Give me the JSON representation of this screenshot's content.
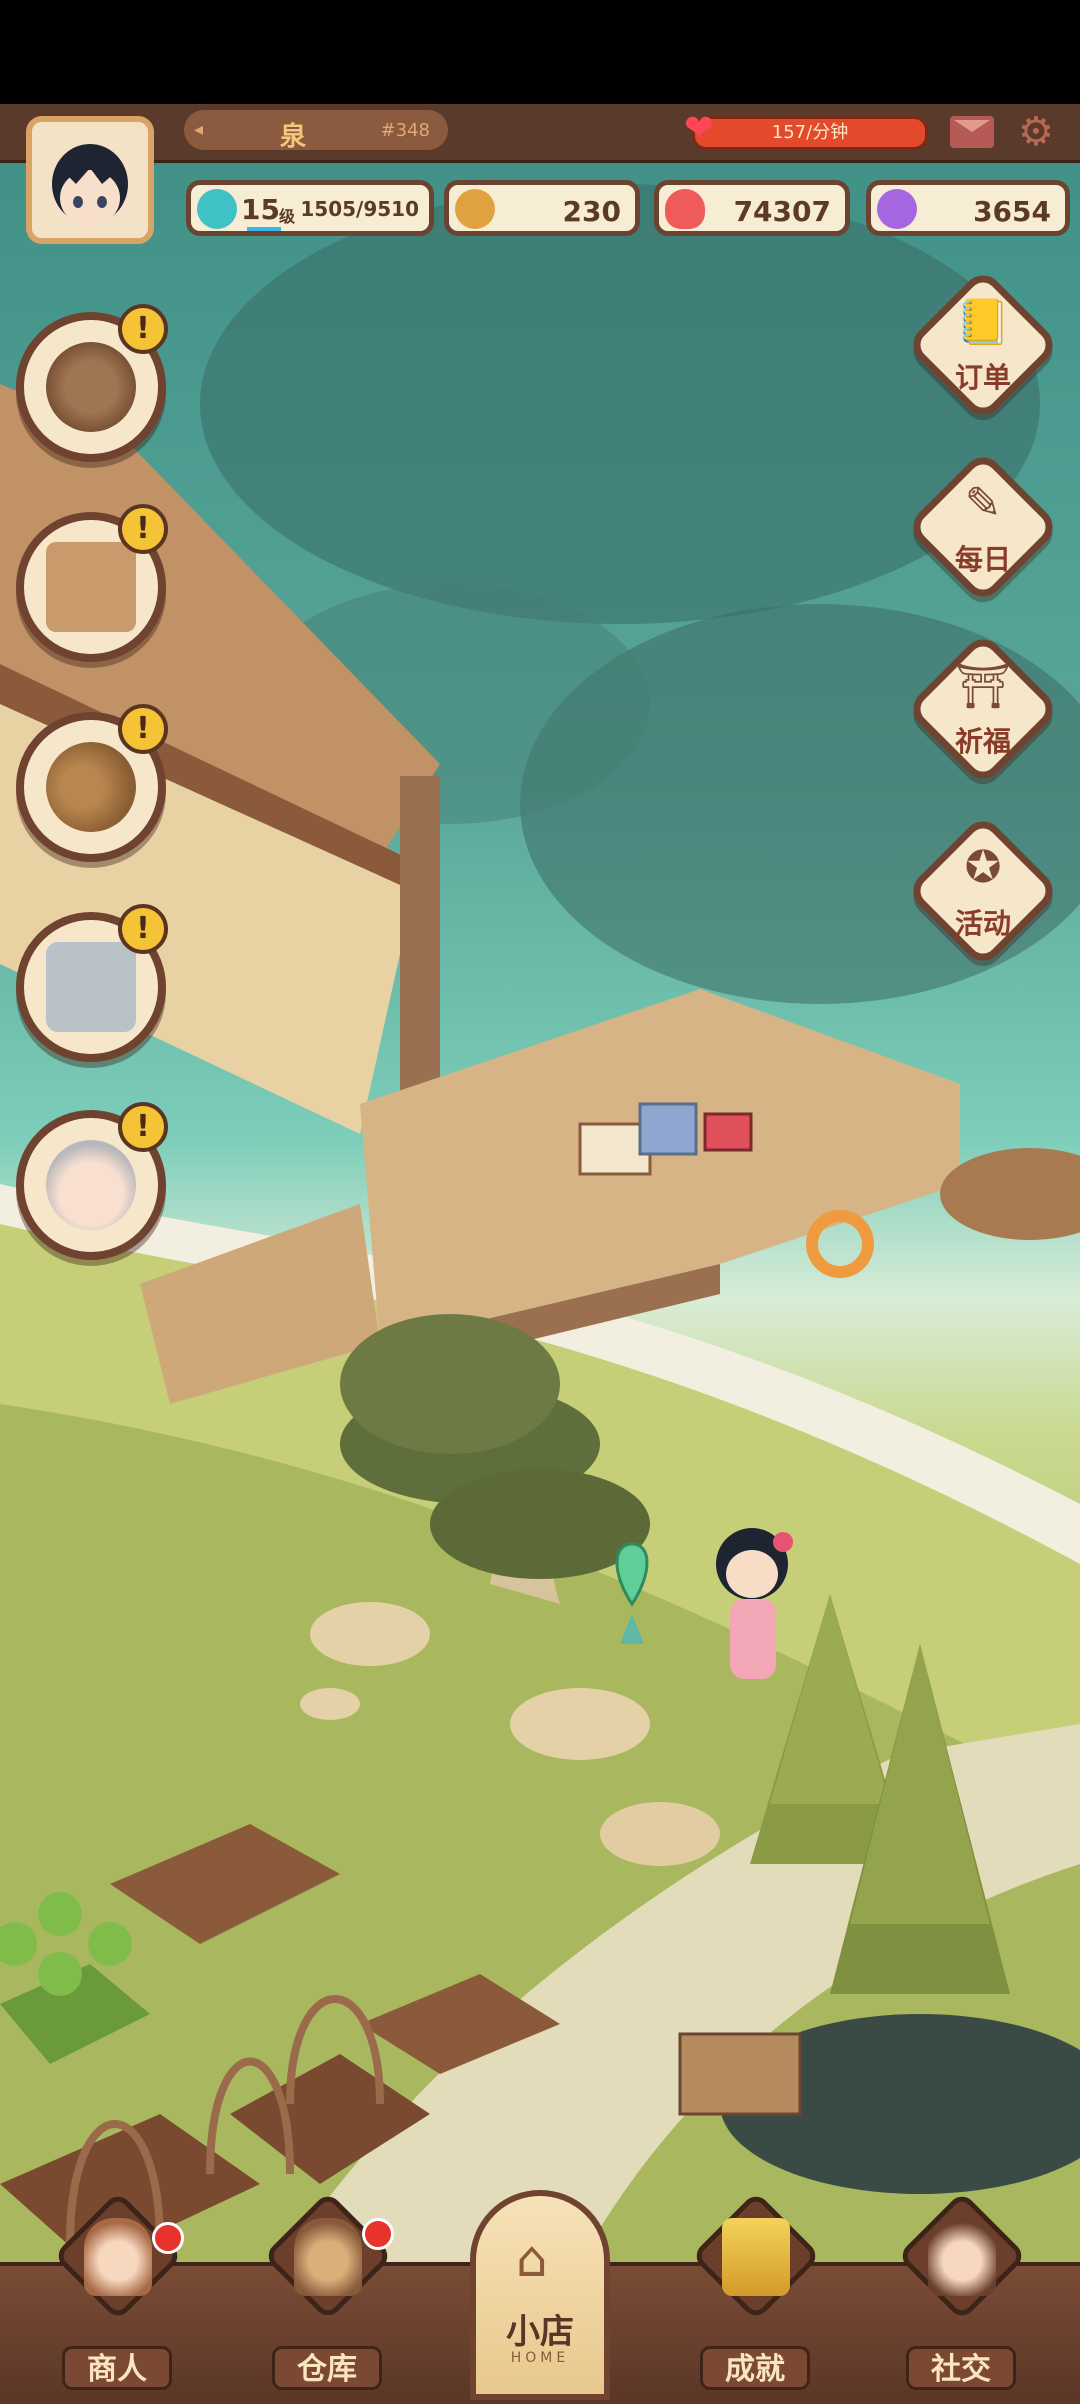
{
  "header": {
    "player_name": "泉",
    "player_id": "#348",
    "energy_rate": "157/分钟"
  },
  "stats": {
    "level": "15",
    "level_unit": "级",
    "exp": "1505/9510",
    "coins": "230",
    "hearts": "74307",
    "gems": "3654"
  },
  "side_left": {
    "alert_glyph": "!",
    "items": [
      "pot",
      "menu-board",
      "potatoes",
      "tv",
      "grandpa-npc"
    ]
  },
  "side_right": {
    "orders": "订单",
    "daily": "每日",
    "pray": "祈福",
    "events": "活动"
  },
  "bottom_nav": {
    "merchant": "商人",
    "warehouse": "仓库",
    "shop": "小店",
    "shop_sub": "HOME",
    "achievements": "成就",
    "social": "社交"
  },
  "colors": {
    "frame": "#5a3a2a",
    "accent": "#f5c436",
    "notify": "#e8322c"
  }
}
